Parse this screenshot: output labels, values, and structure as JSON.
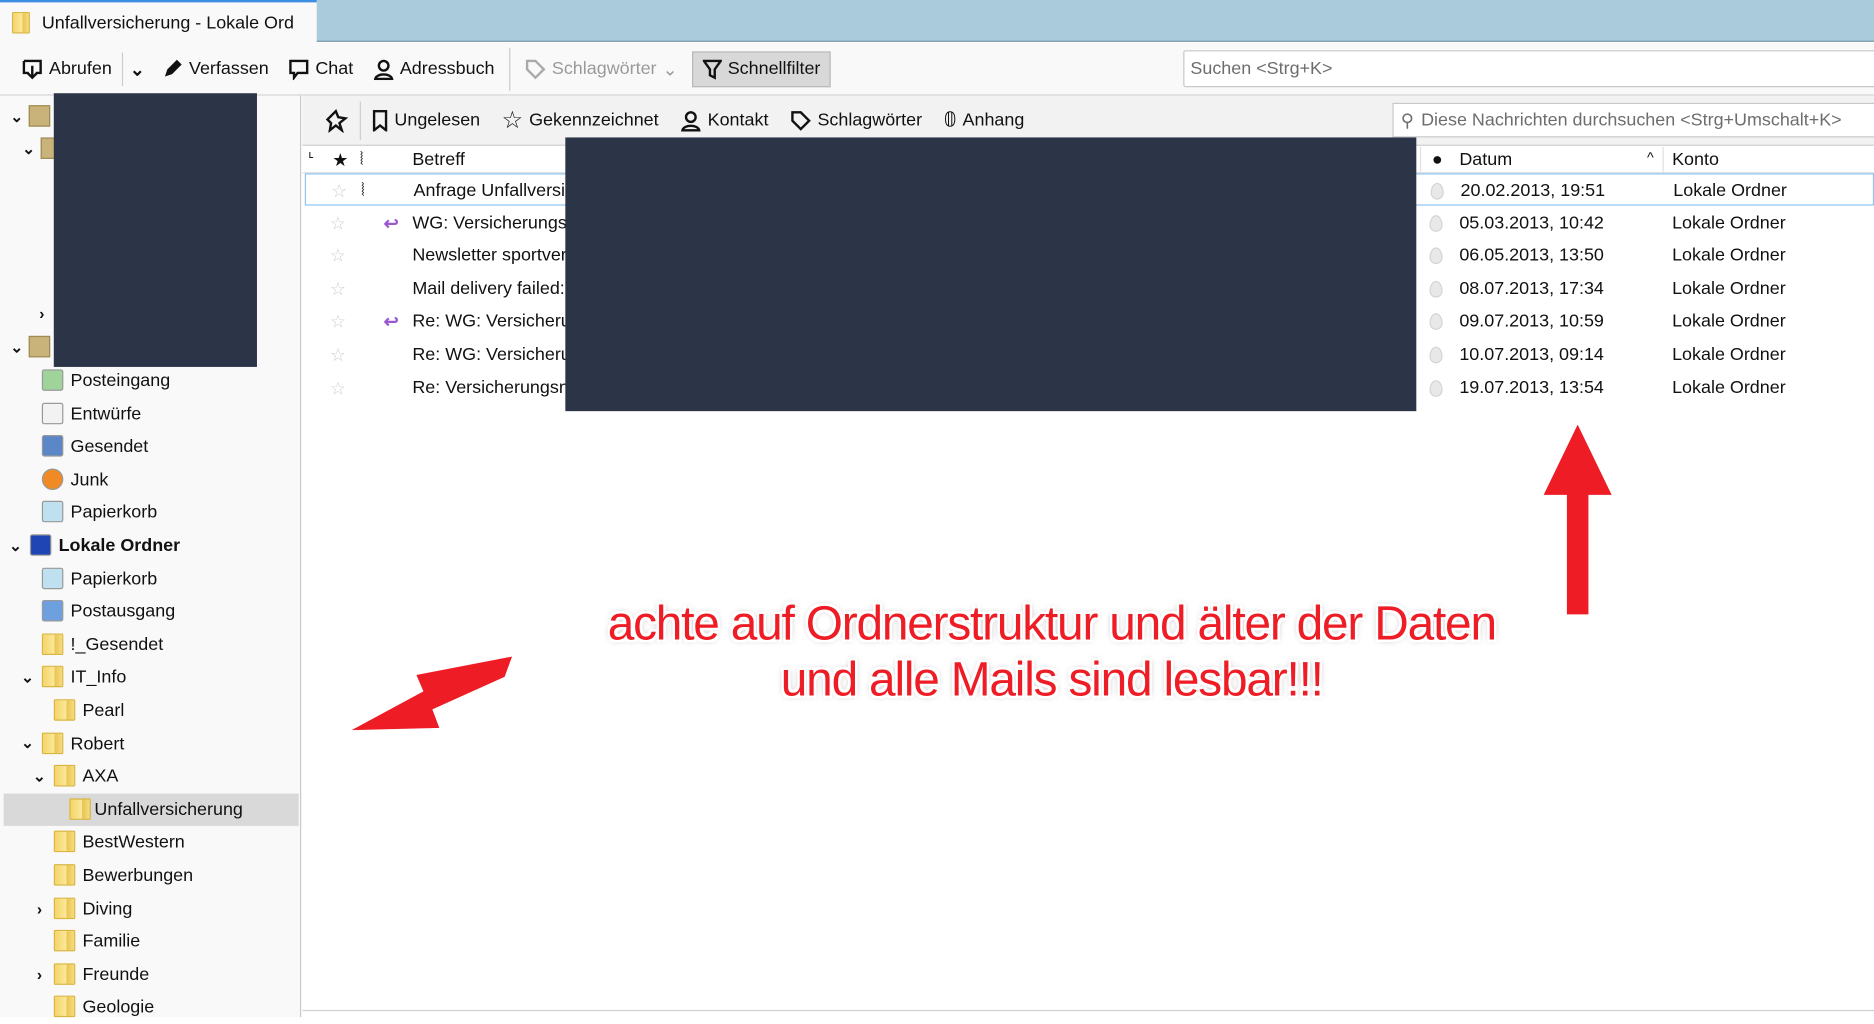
{
  "window": {
    "tab_title": "Unfallversicherung - Lokale Ord"
  },
  "toolbar": {
    "get_mail": "Abrufen",
    "compose": "Verfassen",
    "chat": "Chat",
    "address_book": "Adressbuch",
    "tags": "Schlagwörter",
    "quick_filter": "Schnellfilter"
  },
  "search": {
    "placeholder": "Suchen <Strg+K>"
  },
  "quickfilter": {
    "unread": "Ungelesen",
    "starred": "Gekennzeichnet",
    "contact": "Kontakt",
    "tags": "Schlagwörter",
    "attachment": "Anhang",
    "search_placeholder": "Diese Nachrichten durchsuchen <Strg+Umschalt+K>"
  },
  "columns": {
    "subject": "Betreff",
    "date": "Datum",
    "account": "Konto"
  },
  "folders": [
    {
      "label": "Posteingang",
      "level": 1,
      "icon": "inbox"
    },
    {
      "label": "Entwürfe",
      "level": 1,
      "icon": "drafts"
    },
    {
      "label": "Gesendet",
      "level": 1,
      "icon": "sent"
    },
    {
      "label": "Junk",
      "level": 1,
      "icon": "junk"
    },
    {
      "label": "Papierkorb",
      "level": 1,
      "icon": "trash"
    },
    {
      "label": "Lokale Ordner",
      "level": 0,
      "icon": "local",
      "chevron": "down",
      "bold": true
    },
    {
      "label": "Papierkorb",
      "level": 1,
      "icon": "trash"
    },
    {
      "label": "Postausgang",
      "level": 1,
      "icon": "outbox"
    },
    {
      "label": "!_Gesendet",
      "level": 1,
      "icon": "folder"
    },
    {
      "label": "IT_Info",
      "level": 1,
      "icon": "folder",
      "chevron": "down"
    },
    {
      "label": "Pearl",
      "level": 2,
      "icon": "folder"
    },
    {
      "label": "Robert",
      "level": 1,
      "icon": "folder",
      "chevron": "down"
    },
    {
      "label": "AXA",
      "level": 2,
      "icon": "folder",
      "chevron": "down"
    },
    {
      "label": "Unfallversicherung",
      "level": 3,
      "icon": "folder",
      "selected": true
    },
    {
      "label": "BestWestern",
      "level": 2,
      "icon": "folder"
    },
    {
      "label": "Bewerbungen",
      "level": 2,
      "icon": "folder"
    },
    {
      "label": "Diving",
      "level": 2,
      "icon": "folder",
      "chevron": "right"
    },
    {
      "label": "Familie",
      "level": 2,
      "icon": "folder"
    },
    {
      "label": "Freunde",
      "level": 2,
      "icon": "folder",
      "chevron": "right"
    },
    {
      "label": "Geologie",
      "level": 2,
      "icon": "folder"
    }
  ],
  "messages": [
    {
      "subject": "Anfrage Unfallversic",
      "date": "20.02.2013, 19:51",
      "account": "Lokale Ordner",
      "attachment": true,
      "forwarded": false
    },
    {
      "subject": "WG: Versicherungsa",
      "date": "05.03.2013, 10:42",
      "account": "Lokale Ordner",
      "attachment": false,
      "forwarded": true
    },
    {
      "subject": "Newsletter sportver",
      "date": "06.05.2013, 13:50",
      "account": "Lokale Ordner",
      "attachment": false,
      "forwarded": false
    },
    {
      "subject": "Mail delivery failed:",
      "date": "08.07.2013, 17:34",
      "account": "Lokale Ordner",
      "attachment": false,
      "forwarded": false
    },
    {
      "subject": "Re: WG: Versicherun",
      "date": "09.07.2013, 10:59",
      "account": "Lokale Ordner",
      "attachment": false,
      "forwarded": true
    },
    {
      "subject": "Re: WG: Versicherun",
      "date": "10.07.2013, 09:14",
      "account": "Lokale Ordner",
      "attachment": false,
      "forwarded": false
    },
    {
      "subject": "Re: Versicherungsnr",
      "date": "19.07.2013, 13:54",
      "account": "Lokale Ordner",
      "attachment": false,
      "forwarded": false
    }
  ],
  "annotation": {
    "line1": "achte auf Ordnerstruktur und älter der Daten",
    "line2": "und alle Mails sind lesbar!!!",
    "color": "#ee1c25"
  }
}
